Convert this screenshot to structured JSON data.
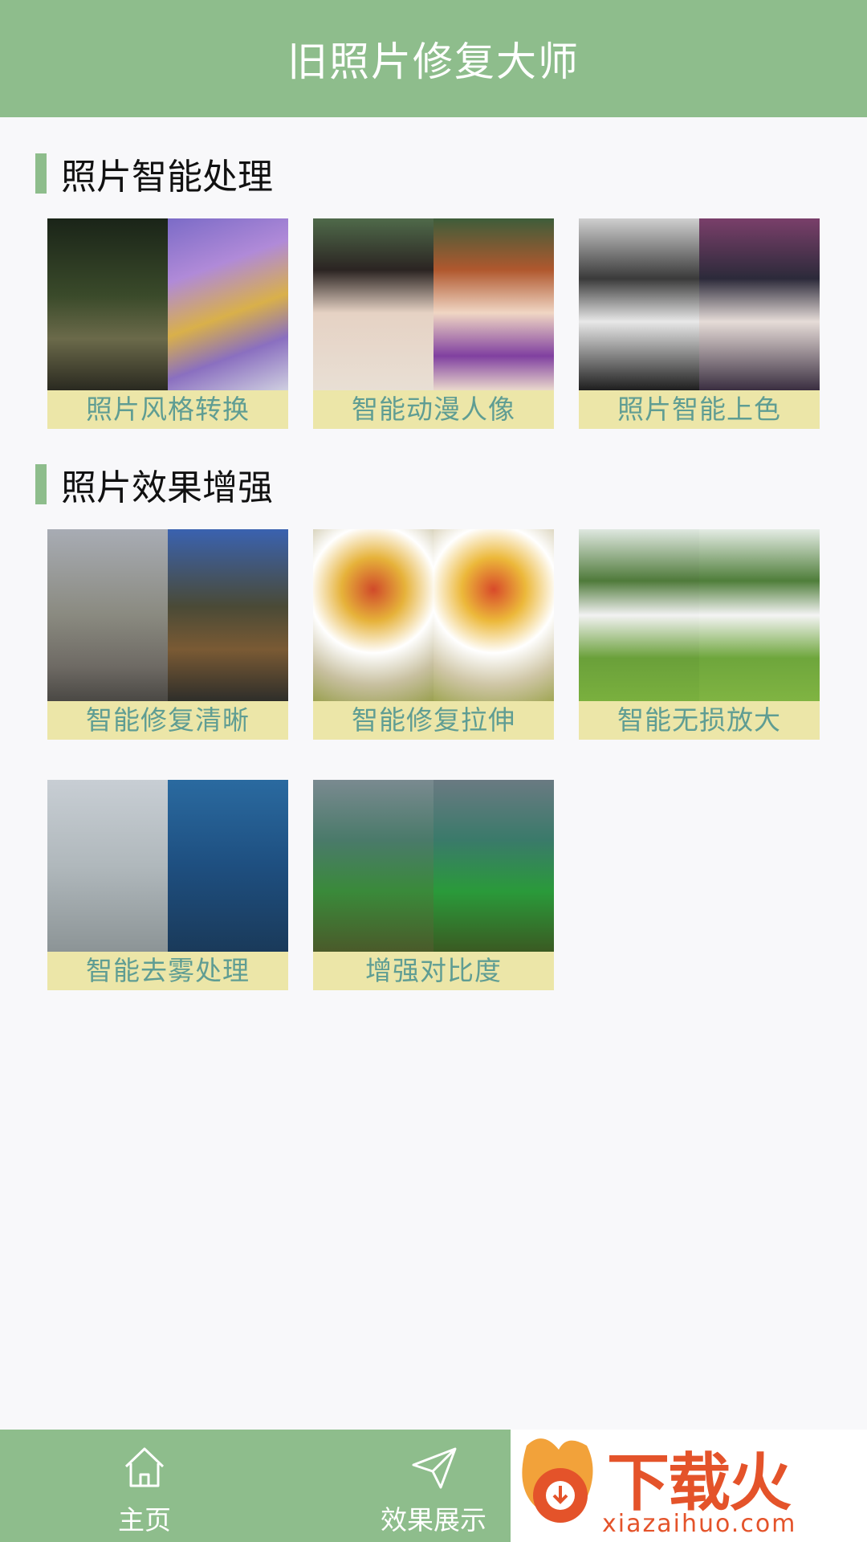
{
  "header": {
    "title": "旧照片修复大师"
  },
  "sections": [
    {
      "title": "照片智能处理",
      "cards": [
        {
          "label": "照片风格转换"
        },
        {
          "label": "智能动漫人像"
        },
        {
          "label": "照片智能上色"
        }
      ]
    },
    {
      "title": "照片效果增强",
      "cards": [
        {
          "label": "智能修复清晰"
        },
        {
          "label": "智能修复拉伸"
        },
        {
          "label": "智能无损放大"
        },
        {
          "label": "智能去雾处理"
        },
        {
          "label": "增强对比度"
        }
      ]
    }
  ],
  "bottom_nav": {
    "items": [
      {
        "label": "主页",
        "icon": "home-icon"
      },
      {
        "label": "效果展示",
        "icon": "send-icon"
      }
    ]
  },
  "ad": {
    "text": "下载火",
    "subtext": "xiazaihuo.com"
  },
  "colors": {
    "accent": "#8ebd8c",
    "label_bg": "#ece6a8",
    "label_text": "#5f9d93",
    "ad_brand": "#e4532a"
  }
}
